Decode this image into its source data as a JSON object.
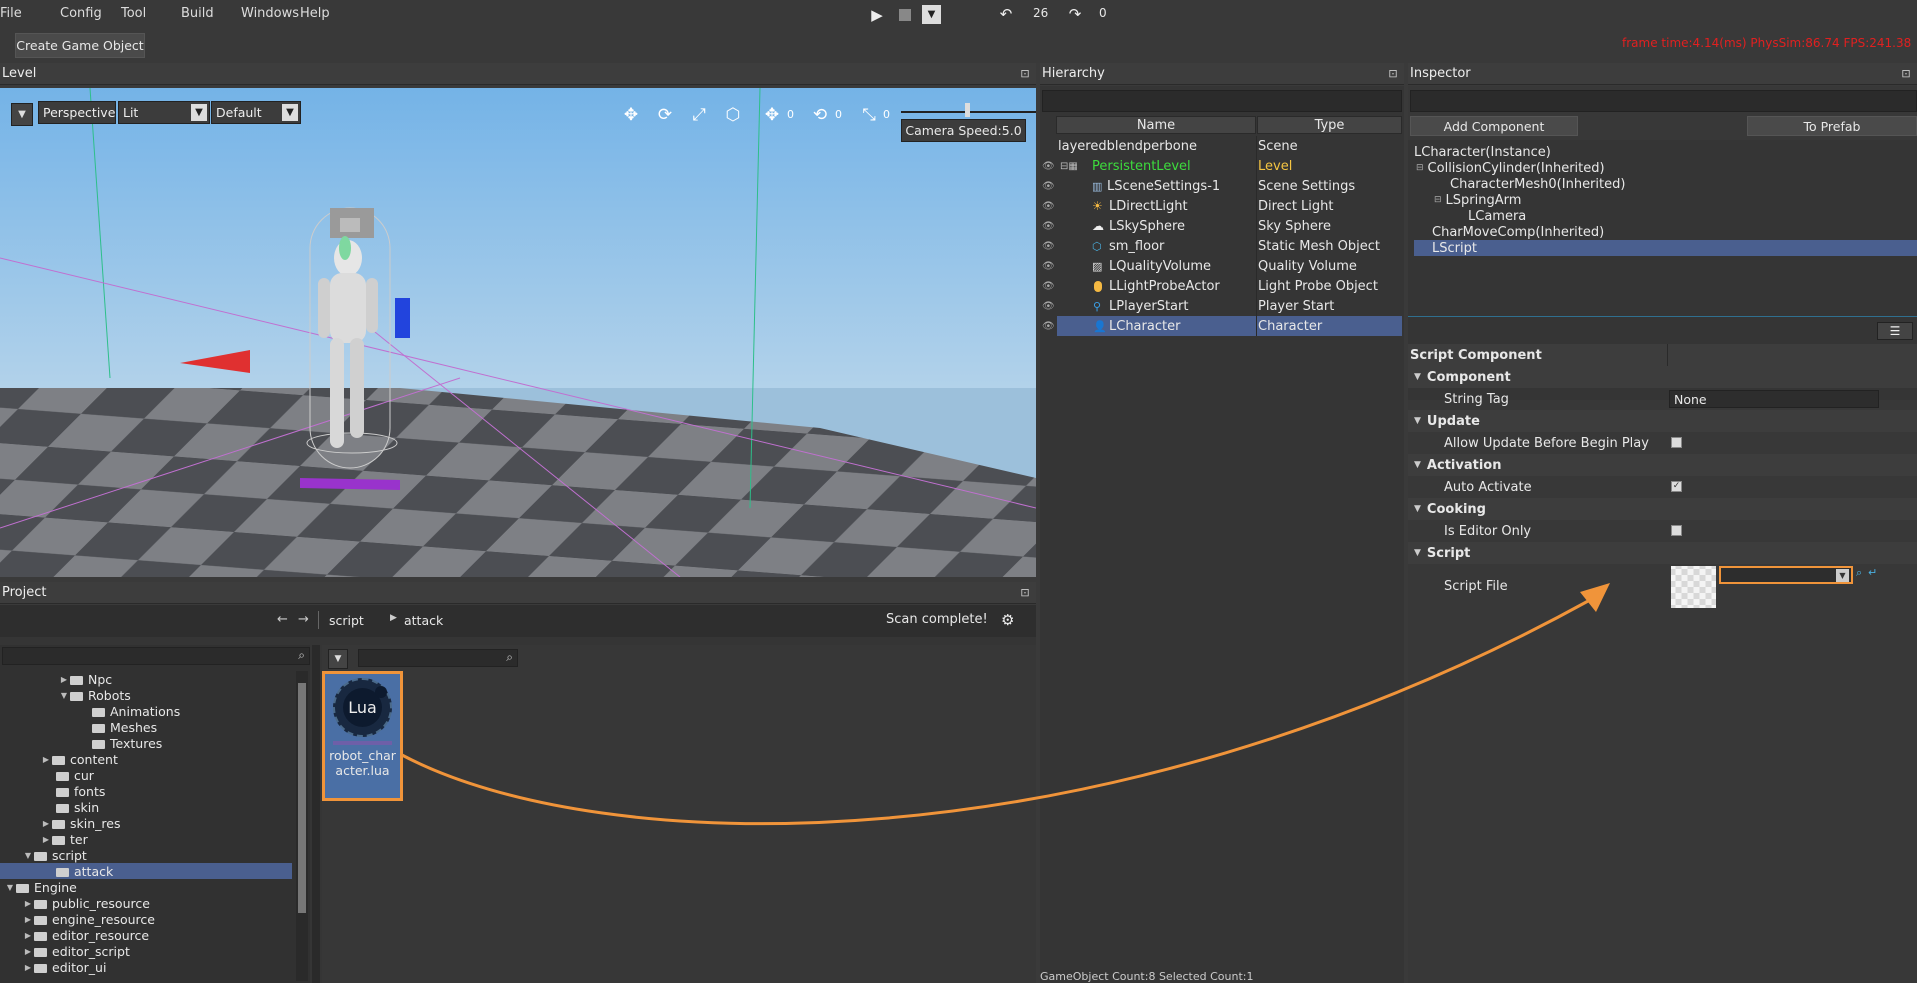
{
  "menu": [
    "File",
    "Config",
    "Tool",
    "Build",
    "Windows",
    "Help"
  ],
  "playbar": {
    "undo_count": "26",
    "redo_count": "0"
  },
  "toolbar": {
    "create_label": "Create Game Object",
    "stats": "frame time:4.14(ms)  PhysSim:86.74  FPS:241.38"
  },
  "level": {
    "title": "Level",
    "perspective": "Perspective",
    "lit": "Lit",
    "default": "Default",
    "camera_speed": "Camera Speed:5.0",
    "gizmo_counts": [
      "0",
      "0",
      "0"
    ]
  },
  "hierarchy": {
    "title": "Hierarchy",
    "col_name": "Name",
    "col_type": "Type",
    "rows": [
      {
        "name": "layeredblendperbone",
        "type": "Scene"
      },
      {
        "name": "PersistentLevel",
        "type": "Level"
      },
      {
        "name": "LSceneSettings-1",
        "type": "Scene Settings"
      },
      {
        "name": "LDirectLight",
        "type": "Direct Light"
      },
      {
        "name": "LSkySphere",
        "type": "Sky Sphere"
      },
      {
        "name": "sm_floor",
        "type": "Static Mesh Object"
      },
      {
        "name": "LQualityVolume",
        "type": "Quality Volume"
      },
      {
        "name": "LLightProbeActor",
        "type": "Light Probe Object"
      },
      {
        "name": "LPlayerStart",
        "type": "Player Start"
      },
      {
        "name": "LCharacter",
        "type": "Character"
      }
    ],
    "footer": "GameObject Count:8    Selected Count:1"
  },
  "inspector": {
    "title": "Inspector",
    "add_component": "Add Component",
    "to_prefab": "To Prefab",
    "tree": [
      "LCharacter(Instance)",
      "CollisionCylinder(Inherited)",
      "CharacterMesh0(Inherited)",
      "LSpringArm",
      "LCamera",
      "CharMoveComp(Inherited)",
      "LScript"
    ],
    "props": {
      "header": "Script Component",
      "component": "Component",
      "string_tag": "String Tag",
      "string_tag_value": "None",
      "update": "Update",
      "allow_update": "Allow Update Before Begin Play",
      "activation": "Activation",
      "auto_activate": "Auto Activate",
      "cooking": "Cooking",
      "editor_only": "Is Editor Only",
      "script": "Script",
      "script_file": "Script File"
    }
  },
  "project": {
    "title": "Project",
    "crumb1": "script",
    "crumb2": "attack",
    "scan": "Scan complete!",
    "asset_label": "robot_character.lua",
    "asset_icon_text": "Lua",
    "folders": [
      "Npc",
      "Robots",
      "Animations",
      "Meshes",
      "Textures",
      "content",
      "cur",
      "fonts",
      "skin",
      "skin_res",
      "ter",
      "script",
      "attack",
      "Engine",
      "public_resource",
      "engine_resource",
      "editor_resource",
      "editor_script",
      "editor_ui"
    ]
  },
  "colors": {
    "accent": "#f0943a",
    "selection": "#4a5f8f",
    "green": "#3ddc3d",
    "red_stats": "#e02020",
    "level_type": "#f5c542"
  }
}
